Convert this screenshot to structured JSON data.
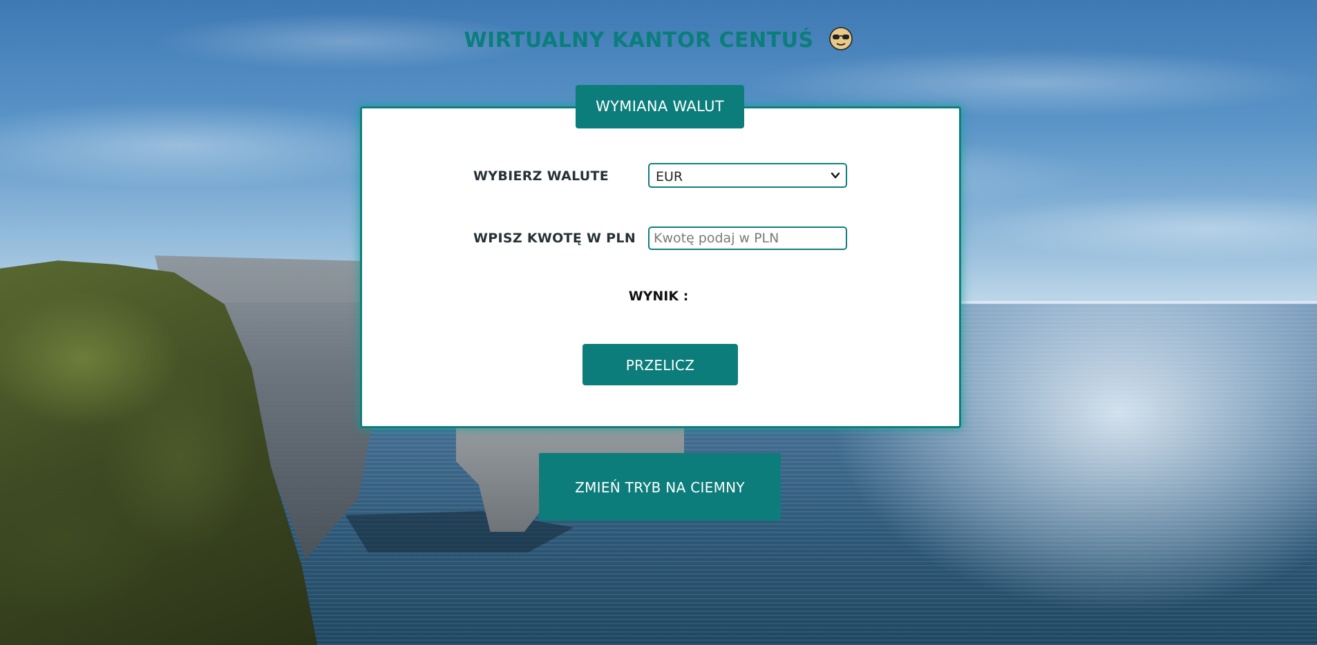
{
  "header": {
    "title": "WIRTUALNY KANTOR CENTUŚ",
    "title_icon": "sunglasses-face-emoji"
  },
  "card": {
    "tab_label": "WYMIANA WALUT",
    "currency_label": "WYBIERZ WALUTE",
    "currency_selected": "EUR",
    "amount_label": "WPISZ KWOTĘ W PLN",
    "amount_value": "",
    "amount_placeholder": "Kwotę podaj w PLN",
    "result_label": "WYNIK :",
    "calculate_button": "PRZELICZ"
  },
  "mode_button": "ZMIEŃ TRYB NA CIEMNY",
  "colors": {
    "accent": "#0c7d7a",
    "title": "#0b7e7b",
    "card_background": "#ffffff",
    "label_text": "#263238"
  }
}
